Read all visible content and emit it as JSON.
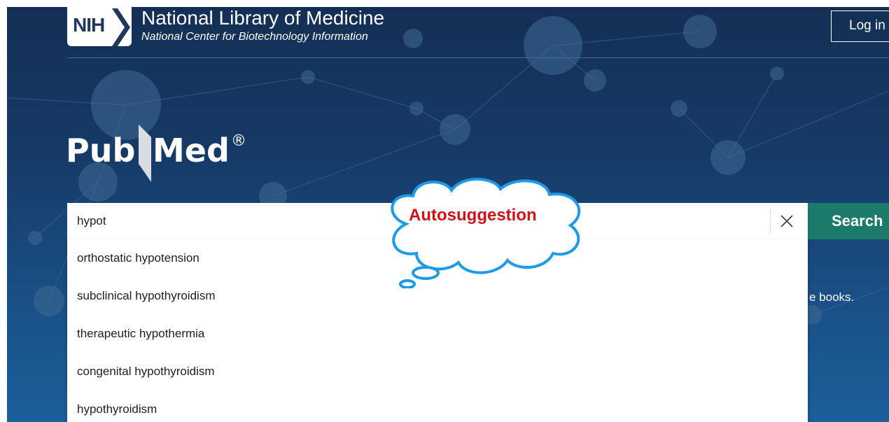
{
  "header": {
    "logo_text": "NIH",
    "title": "National Library of Medicine",
    "subtitle": "National Center for Biotechnology Information",
    "login_label": "Log in"
  },
  "brand": {
    "name": "PubMed",
    "registered_mark": "®"
  },
  "search": {
    "value": "hypot",
    "button_label": "Search",
    "clear_icon": "close-icon"
  },
  "autosuggest": {
    "items": [
      "orthostatic hypotension",
      "subclinical hypothyroidism",
      "therapeutic hypothermia",
      "congenital hypothyroidism",
      "hypothyroidism"
    ]
  },
  "annotation": {
    "label": "Autosuggestion"
  },
  "background_text": "e books.",
  "colors": {
    "background_top": "#142f55",
    "background_bottom": "#1b5f9a",
    "search_button": "#1b7a6a",
    "annotation_text": "#d0121a",
    "annotation_outline": "#1e9be8"
  }
}
